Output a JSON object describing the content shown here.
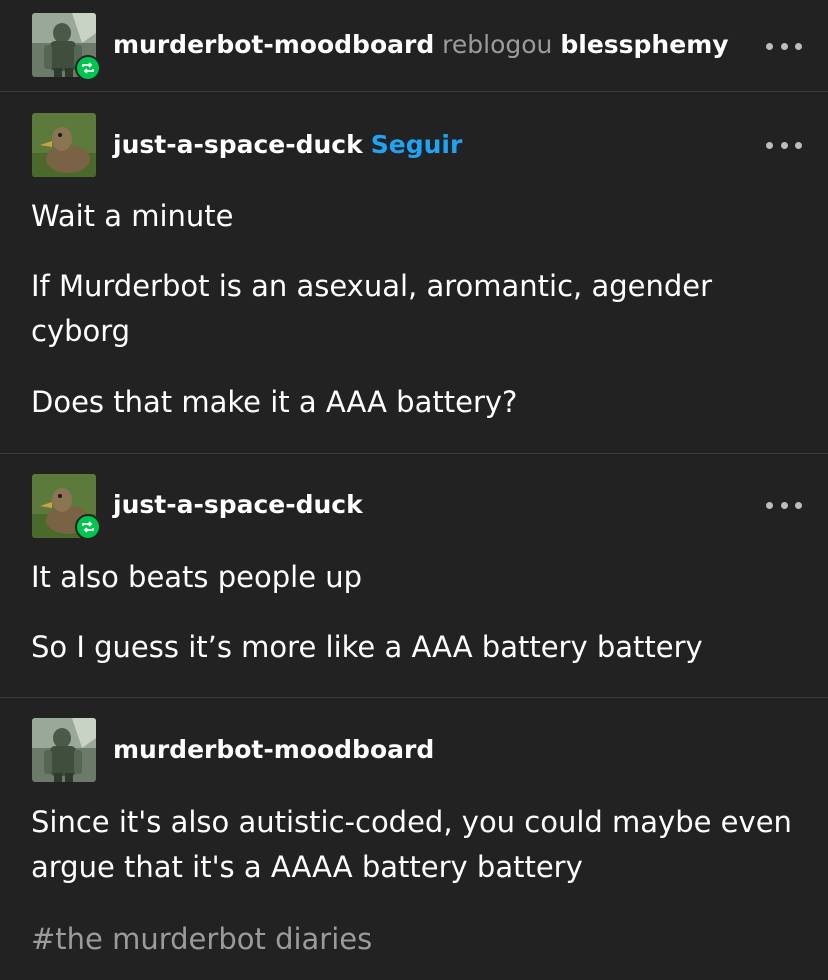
{
  "reblog_header": {
    "username": "murderbot-moodboard",
    "action": "reblogou",
    "source": "blessphemy"
  },
  "posts": [
    {
      "username": "just-a-space-duck",
      "follow_label": "Seguir",
      "paragraphs": [
        "Wait a minute",
        "If Murderbot is an asexual, aromantic, agender cyborg",
        "Does that make it a AAA battery?"
      ]
    },
    {
      "username": "just-a-space-duck",
      "paragraphs": [
        "It also beats people up",
        "So I guess it’s more like a AAA battery battery"
      ]
    },
    {
      "username": "murderbot-moodboard",
      "paragraphs": [
        "Since it's also autistic-coded, you could maybe even argue that it's a AAAA battery battery"
      ],
      "tags": [
        "#the murderbot diaries"
      ]
    }
  ],
  "colors": {
    "background": "#222222",
    "follow_blue": "#1fa3f3",
    "reblog_green": "#00c64f",
    "muted": "#9b9b9b"
  },
  "icons": {
    "reblog": "reblog-icon",
    "more": "more-options-icon"
  }
}
